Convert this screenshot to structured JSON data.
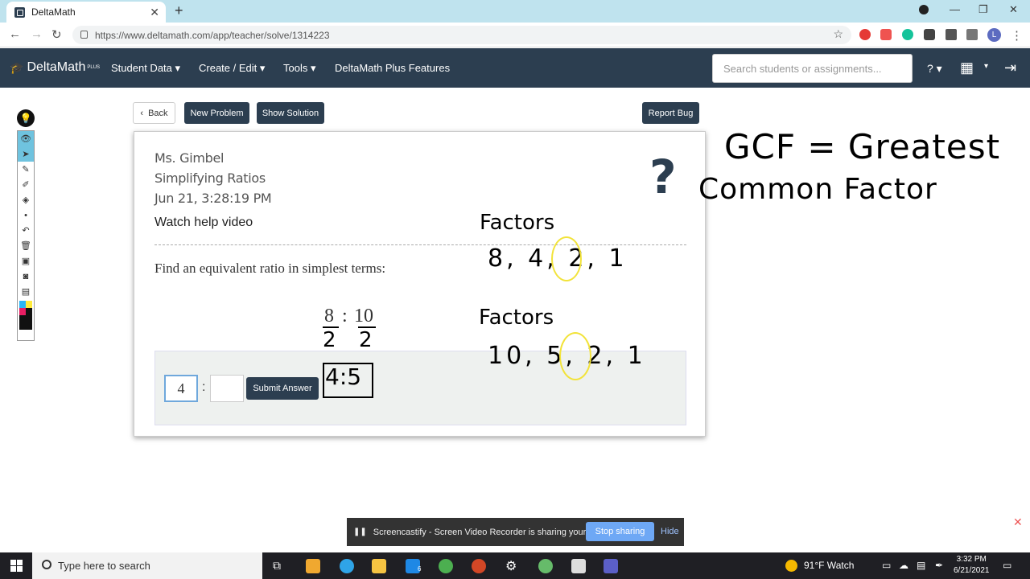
{
  "browser": {
    "tab_title": "DeltaMath",
    "url": "https://www.deltamath.com/app/teacher/solve/1314223",
    "avatar_letter": "L"
  },
  "header": {
    "logo_text": "DeltaMath",
    "logo_sup": "PLUS",
    "menus": [
      "Student Data ▾",
      "Create / Edit ▾",
      "Tools ▾",
      "DeltaMath Plus Features"
    ],
    "search_placeholder": "Search students or assignments...",
    "help_label": "? ▾"
  },
  "actions": {
    "back": "Back",
    "new_problem": "New Problem",
    "show_solution": "Show Solution",
    "report_bug": "Report Bug"
  },
  "problem": {
    "teacher": "Ms. Gimbel",
    "topic": "Simplifying Ratios",
    "timestamp": "Jun 21, 3:28:19 PM",
    "help_link": "Watch help video",
    "prompt": "Find an equivalent ratio in simplest terms:",
    "ratio_left": "8",
    "ratio_right": "10",
    "ratio_sep": ":",
    "answer_left_value": "4",
    "answer_right_value": "",
    "answer_sep": ":",
    "submit_label": "Submit Answer",
    "help_icon": "?"
  },
  "annotations": {
    "gcf_line1": "GCF = Greatest",
    "gcf_line2": "Common Factor",
    "factors_label_1": "Factors",
    "factors_list_1": "8, 4, 2, 1",
    "factors_label_2": "Factors",
    "factors_list_2": "10, 5, 2, 1",
    "divisor_left": "2",
    "divisor_right": "2",
    "result_ratio": "4:5",
    "highlight_color": "#f2e33a"
  },
  "screencast": {
    "message": "Screencastify - Screen Video Recorder is sharing your screen.",
    "stop_label": "Stop sharing",
    "hide_label": "Hide"
  },
  "taskbar": {
    "search_placeholder": "Type here to search",
    "weather": "91°F  Watch",
    "time": "3:32 PM",
    "date": "6/21/2021",
    "mail_badge": "6"
  },
  "colors": {
    "brand_dark": "#2c3e50",
    "accent_blue": "#6fa8dc"
  }
}
